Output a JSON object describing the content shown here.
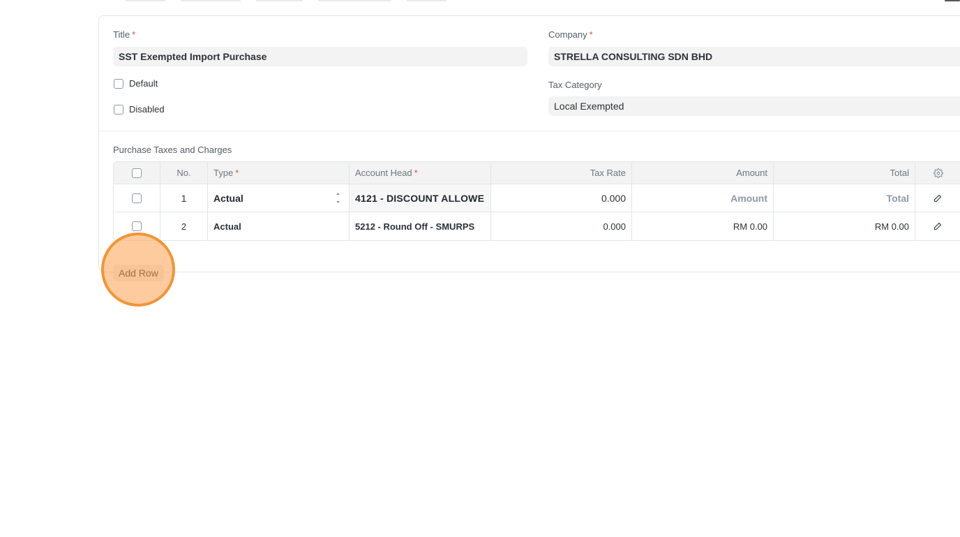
{
  "form": {
    "title": {
      "label": "Title",
      "required_mark": "*",
      "value": "SST Exempted Import Purchase"
    },
    "company": {
      "label": "Company",
      "required_mark": "*",
      "value": "STRELLA CONSULTING SDN BHD"
    },
    "default_checkbox": {
      "label": "Default",
      "checked": false
    },
    "disabled_checkbox": {
      "label": "Disabled",
      "checked": false
    },
    "tax_category": {
      "label": "Tax Category",
      "value": "Local Exempted"
    }
  },
  "taxes_table": {
    "label": "Purchase Taxes and Charges",
    "columns": {
      "no": "No.",
      "type": "Type",
      "type_required": "*",
      "account_head": "Account Head",
      "account_head_required": "*",
      "tax_rate": "Tax Rate",
      "amount": "Amount",
      "total": "Total"
    },
    "rows": [
      {
        "no": "1",
        "type": "Actual",
        "account_head": "4121 - DISCOUNT ALLOWE",
        "tax_rate": "0.000",
        "amount": "Amount",
        "total": "Total"
      },
      {
        "no": "2",
        "type": "Actual",
        "account_head": "5212 - Round Off - SMURPS",
        "tax_rate": "0.000",
        "amount": "RM 0.00",
        "total": "RM 0.00"
      }
    ],
    "add_row_label": "Add Row"
  },
  "icons": {
    "settings": "gear-icon",
    "edit": "pencil-icon",
    "select": "sort-arrows-icon"
  },
  "colors": {
    "required": "#e24c4c",
    "click_indicator": "#f29537"
  }
}
